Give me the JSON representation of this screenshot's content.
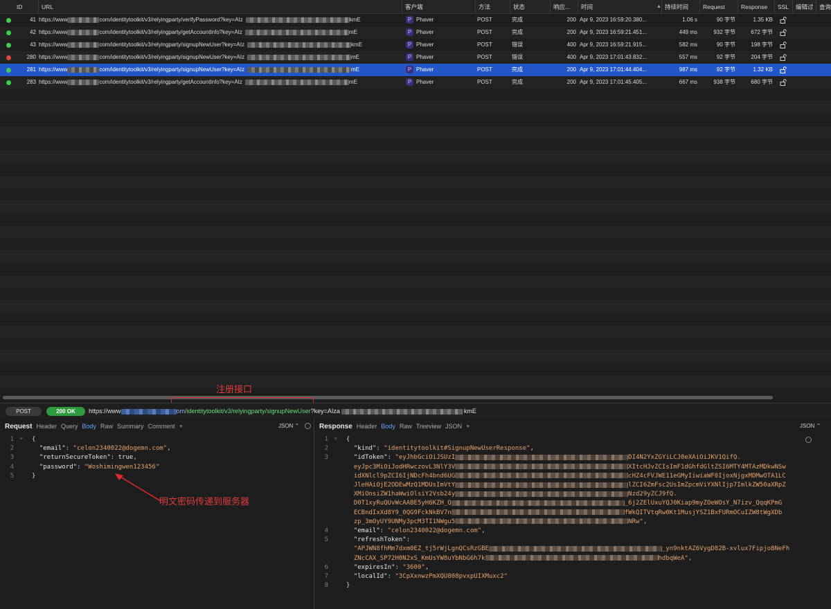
{
  "table": {
    "columns": [
      "ID",
      "URL",
      "客户端",
      "方法",
      "状态",
      "响应...",
      "时间",
      "持续时间",
      "Request",
      "Response",
      "SSL",
      "编辑过",
      "查询"
    ],
    "rows": [
      {
        "id": "41",
        "url_start": "https://www",
        "url_end": "com/identitytoolkit/v3/relyingparty/verifyPassword?key=AIz",
        "url_tail": "kmE",
        "client": "Phaver",
        "method": "POST",
        "status": "完成",
        "code": "200",
        "time": "Apr 9, 2023 16:59:20.380...",
        "duration": "1.06 s",
        "request": "90 字节",
        "response": "1.35 KB",
        "dot": "#3ecf4f"
      },
      {
        "id": "42",
        "url_start": "https://www",
        "url_end": "com/identitytoolkit/v3/relyingparty/getAccountInfo?key=AIz",
        "url_tail": "mE",
        "client": "Phaver",
        "method": "POST",
        "status": "完成",
        "code": "200",
        "time": "Apr 9, 2023 16:59:21.451...",
        "duration": "449 ms",
        "request": "932 字节",
        "response": "672 字节",
        "dot": "#3ecf4f"
      },
      {
        "id": "43",
        "url_start": "https://www",
        "url_end": "com/identitytoolkit/v3/relyingparty/signupNewUser?key=AIz",
        "url_tail": "kmE",
        "client": "Phaver",
        "method": "POST",
        "status": "错误",
        "code": "400",
        "time": "Apr 9, 2023 16:59:21.915...",
        "duration": "582 ms",
        "request": "90 字节",
        "response": "198 字节",
        "dot": "#3ecf4f"
      },
      {
        "id": "280",
        "url_start": "https://www",
        "url_end": "com/identitytoolkit/v3/relyingparty/signupNewUser?key=AIz",
        "url_tail": "mE",
        "client": "Phaver",
        "method": "POST",
        "status": "错误",
        "code": "400",
        "time": "Apr 9, 2023 17:01:43.832...",
        "duration": "557 ms",
        "request": "92 字节",
        "response": "204 字节",
        "dot": "#e0443e"
      },
      {
        "id": "281",
        "url_start": "https://www",
        "url_end": "com/identitytoolkit/v3/relyingparty/signupNewUser?key=AIz",
        "url_tail": "mE",
        "client": "Phaver",
        "method": "POST",
        "status": "完成",
        "code": "200",
        "time": "Apr 9, 2023 17:01:44.404...",
        "duration": "987 ms",
        "request": "92 字节",
        "response": "1.32 KB",
        "dot": "#3ecf4f"
      },
      {
        "id": "283",
        "url_start": "https://www",
        "url_end": "com/identitytoolkit/v3/relyingparty/getAccountInfo?key=AIz",
        "url_tail": "mE",
        "client": "Phaver",
        "method": "POST",
        "status": "完成",
        "code": "200",
        "time": "Apr 9, 2023 17:01:45.405...",
        "duration": "667 ms",
        "request": "938 字节",
        "response": "680 字节",
        "dot": "#3ecf4f"
      }
    ],
    "selected_index": 4
  },
  "urlbar": {
    "method": "POST",
    "status": "200 OK",
    "url_prefix": "https://www",
    "url_mid": "om",
    "url_path": "/identitytoolkit/v3/relyingparty/signupNewUser",
    "url_query": "?key=AIza",
    "url_tail": "kmE"
  },
  "request_pane": {
    "title": "Request",
    "tabs": [
      "Header",
      "Query",
      "Body",
      "Raw",
      "Summary",
      "Comment"
    ],
    "active_tab": "Body",
    "format": "JSON",
    "lines": [
      {
        "n": "1",
        "text": "{"
      },
      {
        "n": "2",
        "key": "\"email\"",
        "value": "\"celon2340022@dogemn.com\"",
        "tail": ","
      },
      {
        "n": "3",
        "key": "\"returnSecureToken\"",
        "value_plain": "true",
        "tail": ","
      },
      {
        "n": "4",
        "key": "\"password\"",
        "value": "\"Woshimingwen123456\""
      },
      {
        "n": "5",
        "text": "}"
      }
    ]
  },
  "response_pane": {
    "title": "Response",
    "tabs": [
      "Header",
      "Body",
      "Raw",
      "Treeview",
      "JSON"
    ],
    "active_tab": "Body",
    "format": "JSON",
    "lines": [
      {
        "n": "1",
        "text": "{"
      },
      {
        "n": "2",
        "key": "\"kind\"",
        "value": "\"identitytoolkit#SignupNewUserResponse\"",
        "tail": ","
      },
      {
        "n": "3",
        "key": "\"idToken\"",
        "value": "\"eyJhbGciOiJSUzI",
        "value_end": "DI4N2YxZGYiLCJ0eXAiOiJKV1QifQ."
      },
      {
        "n": "",
        "value": "eyJpc3MiOiJodHRwczovL3NlY3V",
        "value_end": "XItcHJvZCIsImF1dGhfdGltZSI6MTY4MTAzMDkwNSw"
      },
      {
        "n": "",
        "value": "idXNlcl9pZCI6IjNDcFh4bnd6UG",
        "value_end": "cHZ4cFVJWE11eGMyIiwiaWF0IjoxNjgxMDMwOTA1LC"
      },
      {
        "n": "",
        "value": "JleHAiOjE2ODEwMzQ1MDUsImVtY",
        "value_end": "lZCI6ZmFsc2UsImZpcmViYXNlIjp7ImlkZW50aXRpZ"
      },
      {
        "n": "",
        "value": "XMiOnsiZW1haWwiOlsiY2Vsb24y",
        "value_end": "Nzd29yZCJ9fQ."
      },
      {
        "n": "",
        "value": "D0T1xyRuQUvWcAABE5yH6KZH_Q",
        "value_end": "_6j2ZElUxuYQJ0Kiap9myZOeWOsY_N7izv_QqqKPmG"
      },
      {
        "n": "",
        "value": "ECBndIxXd8Y9_0QG9FckNkBV7n",
        "value_end": "fWkQITVtqRw0Kt1MusjYSZ1BxFURmOCuIZW8tWgXDb"
      },
      {
        "n": "",
        "value": "zp_3mOyUY9UNMy3pcM3TI1NWgu5",
        "value_end": "NRw\","
      },
      {
        "n": "4",
        "key": "\"email\"",
        "value": "\"celon2340022@dogemn.com\"",
        "tail": ","
      },
      {
        "n": "5",
        "key": "\"refreshToken\"",
        "value": ""
      },
      {
        "n": "",
        "value": "\"APJWN8fhMm7dxm0EZ_tj5rWjLgnQCsRzGBE",
        "value_end": "_yn9nktAZ6VygD82B-xvlux7Fipjo8NeFh"
      },
      {
        "n": "",
        "value": "ZNcCAX_SP72H0N2xS_KmUsYW8uYbNbG6h7k",
        "value_end": "hdbqWeA\","
      },
      {
        "n": "6",
        "key": "\"expiresIn\"",
        "value": "\"3600\"",
        "tail": ","
      },
      {
        "n": "7",
        "key": "\"localId\"",
        "value": "\"3CpXxnwzPmXQU808pvxpUIXMuxc2\""
      },
      {
        "n": "8",
        "text": "}"
      }
    ]
  },
  "annotations": {
    "register_label": "注册接口",
    "plaintext_label": "明文密码传递到服务器"
  }
}
